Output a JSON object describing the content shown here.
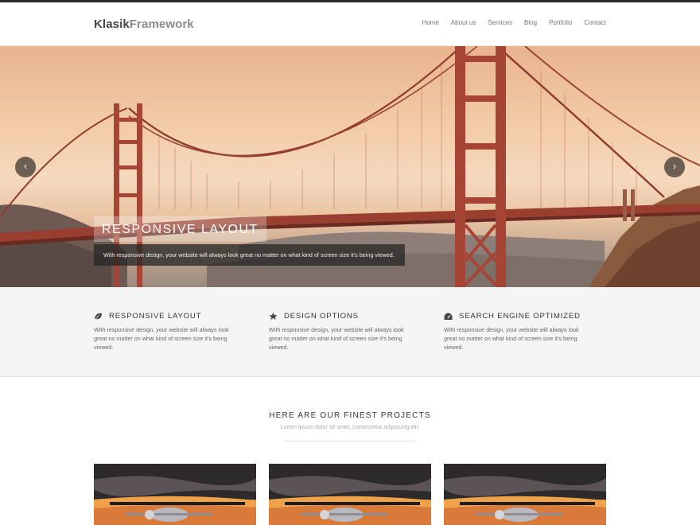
{
  "header": {
    "logo_primary": "Klasik",
    "logo_secondary": "Framework",
    "nav": [
      "Home",
      "About us",
      "Services",
      "Blog",
      "Portfolio",
      "Contact"
    ]
  },
  "slider": {
    "caption_title": "RESPONSIVE LAYOUT",
    "caption_text": "With responsive design, your website will always look great no matter on what kind of screen size it's being viewed.",
    "prev_icon": "chevron-left-icon",
    "next_icon": "chevron-right-icon"
  },
  "features": [
    {
      "icon": "leaf-icon",
      "title": "RESPONSIVE LAYOUT",
      "text": "With responsive design, your website will always look great no matter on what kind of screen size it's being viewed."
    },
    {
      "icon": "star-icon",
      "title": "DESIGN OPTIONS",
      "text": "With responsive design, your website will always look great no matter on what kind of screen size it's being viewed."
    },
    {
      "icon": "dashboard-icon",
      "title": "SEARCH ENGINE OPTIMIZED",
      "text": "With responsive design, your website will always look great no matter on what kind of screen size it's being viewed."
    }
  ],
  "projects": {
    "title": "HERE ARE OUR FINEST PROJECTS",
    "subtitle": "Lorem ipsum dolor sit amet, consectetur adipiscing elit."
  },
  "colors": {
    "topbar": "#2b2b2b",
    "bridge": "#a64535",
    "features_bg": "#f5f5f5"
  }
}
